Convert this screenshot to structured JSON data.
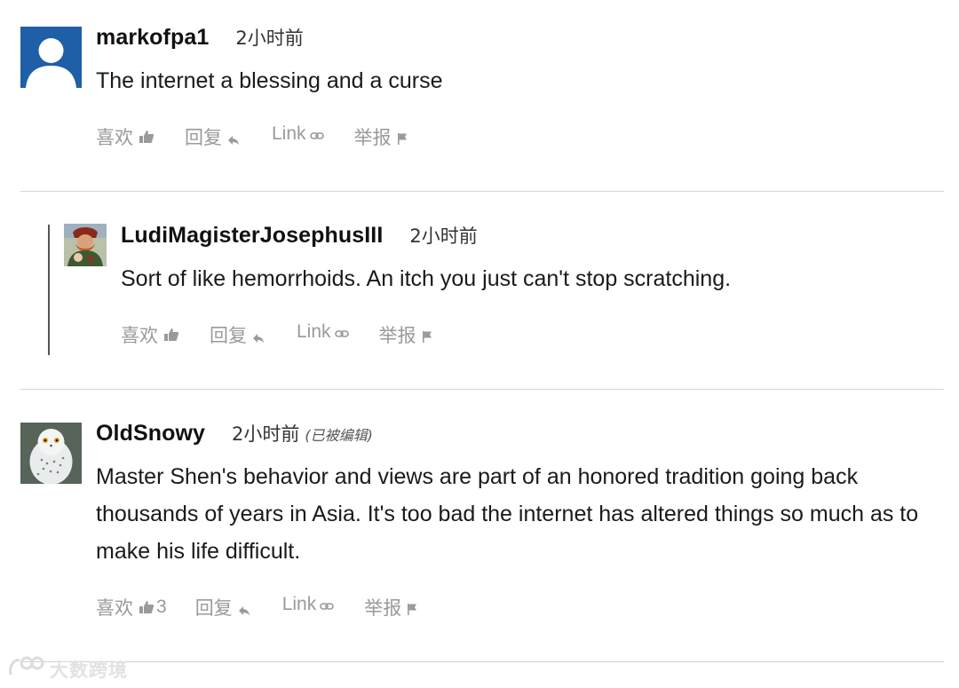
{
  "comments": [
    {
      "username": "markofpa1",
      "time": "2小时前",
      "text": "The internet a blessing and a curse",
      "actions": {
        "like": "喜欢",
        "reply": "回复",
        "link": "Link",
        "report": "举报"
      }
    },
    {
      "username": "LudiMagisterJosephusIII",
      "time": "2小时前",
      "text": "Sort of like hemorrhoids.  An itch you just can't stop scratching.",
      "actions": {
        "like": "喜欢",
        "reply": "回复",
        "link": "Link",
        "report": "举报"
      }
    },
    {
      "username": "OldSnowy",
      "time": "2小时前",
      "edited": "(已被编辑)",
      "text": "Master Shen's behavior and views are part of an honored tradition going back thousands of years in Asia. It's too bad the internet has altered things so much as to make his life difficult.",
      "like_count": "3",
      "actions": {
        "like": "喜欢",
        "reply": "回复",
        "link": "Link",
        "report": "举报"
      }
    }
  ],
  "icons": {
    "like": "thumbs-up-icon",
    "reply": "reply-arrow-icon",
    "link": "chain-link-icon",
    "report": "flag-icon"
  },
  "colors": {
    "action_gray": "#9a9a9a",
    "avatar_blue": "#1f5fa8",
    "divider": "#d4d4d4"
  },
  "watermark": "大数跨境"
}
